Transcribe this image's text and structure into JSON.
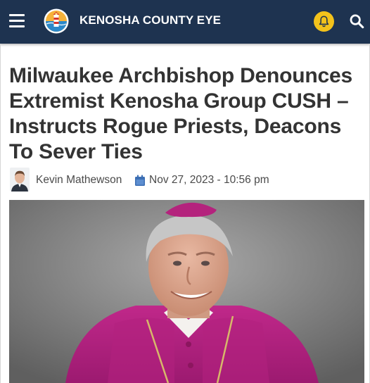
{
  "header": {
    "site_title": "KENOSHA COUNTY EYE",
    "icons": {
      "menu": "hamburger-menu-icon",
      "logo": "lighthouse-logo",
      "notifications": "bell-icon",
      "search": "search-icon"
    },
    "colors": {
      "bar": "#1e3350",
      "bell_badge": "#f3c21b",
      "text": "#ffffff"
    }
  },
  "article": {
    "headline": "Milwaukee Archbishop Denounces Extremist Kenosha Group CUSH – Instructs Rogue Priests, Deacons To Sever Ties",
    "author": "Kevin Mathewson",
    "date": "Nov 27, 2023 - 10:56 pm",
    "hero_image": "portrait of archbishop in magenta vestments",
    "colors": {
      "headline": "#333333",
      "calendar_icon": "#3d6fb4"
    }
  }
}
